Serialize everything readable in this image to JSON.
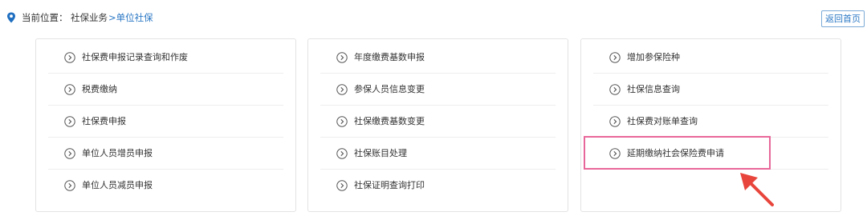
{
  "breadcrumb": {
    "prefix": "当前位置：",
    "category": "社保业务",
    "current": ">单位社保"
  },
  "header": {
    "home_button_label": "返回首页"
  },
  "panels": [
    {
      "items": [
        {
          "label": "社保费申报记录查询和作废"
        },
        {
          "label": "税费缴纳"
        },
        {
          "label": "社保费申报"
        },
        {
          "label": "单位人员增员申报"
        },
        {
          "label": "单位人员减员申报"
        }
      ]
    },
    {
      "items": [
        {
          "label": "年度缴费基数申报"
        },
        {
          "label": "参保人员信息变更"
        },
        {
          "label": "社保缴费基数变更"
        },
        {
          "label": "社保账目处理"
        },
        {
          "label": "社保证明查询打印"
        }
      ]
    },
    {
      "items": [
        {
          "label": "增加参保险种"
        },
        {
          "label": "社保信息查询"
        },
        {
          "label": "社保费对账单查询"
        },
        {
          "label": "延期缴纳社会保险费申请"
        }
      ]
    }
  ],
  "colors": {
    "accent": "#2b78c5",
    "highlight": "#e8679a",
    "pointer": "#e8453c",
    "location_icon": "#1f6fc1"
  },
  "icons": {
    "location": "location-pin-icon",
    "item_arrow": "circle-chevron-right-icon",
    "annotation": "red-pointer-arrow"
  }
}
